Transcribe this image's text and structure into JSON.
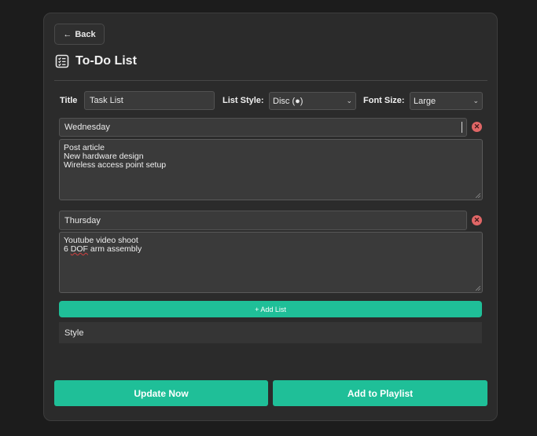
{
  "back_label": "Back",
  "header": {
    "title": "To-Do List"
  },
  "settings": {
    "title_label": "Title",
    "title_value": "Task List",
    "list_style_label": "List Style:",
    "list_style_value": "Disc (●)",
    "font_size_label": "Font Size:",
    "font_size_value": "Large"
  },
  "lists": [
    {
      "name": "Wednesday",
      "items": [
        "Post article",
        "New hardware design",
        "Wireless access point setup"
      ]
    },
    {
      "name": "Thursday",
      "items": [
        "Youtube video shoot",
        "6 DOF arm assembly"
      ]
    }
  ],
  "add_list_label": "+ Add List",
  "style_label": "Style",
  "actions": {
    "update": "Update Now",
    "playlist": "Add to Playlist"
  },
  "colors": {
    "accent": "#1fbf98",
    "panel": "#2b2b2b",
    "remove": "#e06666"
  }
}
